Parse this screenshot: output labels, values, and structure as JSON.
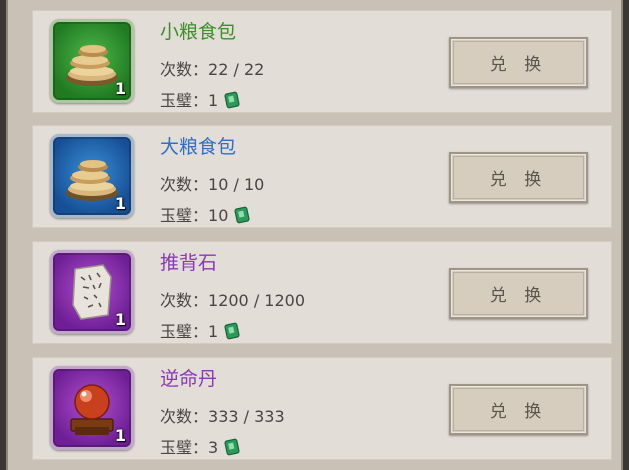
{
  "items": [
    {
      "name": "小粮食包",
      "name_color": "#3e8f2a",
      "count_label": "次数：",
      "count": "22 / 22",
      "cost_label": "玉璧：",
      "cost": "1",
      "quantity": "1",
      "button": "兑 换",
      "rarity": "green",
      "icon": "grain-sack-small-icon"
    },
    {
      "name": "大粮食包",
      "name_color": "#2d6fc4",
      "count_label": "次数：",
      "count": "10 / 10",
      "cost_label": "玉璧：",
      "cost": "10",
      "quantity": "1",
      "button": "兑 换",
      "rarity": "blue",
      "icon": "grain-sack-large-icon"
    },
    {
      "name": "推背石",
      "name_color": "#8a38b5",
      "count_label": "次数：",
      "count": "1200 / 1200",
      "cost_label": "玉璧：",
      "cost": "1",
      "quantity": "1",
      "button": "兑 换",
      "rarity": "purple",
      "icon": "stone-tablet-icon"
    },
    {
      "name": "逆命丹",
      "name_color": "#8a38b5",
      "count_label": "次数：",
      "count": "333 / 333",
      "cost_label": "玉璧：",
      "cost": "3",
      "quantity": "1",
      "button": "兑 换",
      "rarity": "purple",
      "icon": "crystal-orb-icon"
    }
  ],
  "currency_icon": "jade-bi-icon"
}
